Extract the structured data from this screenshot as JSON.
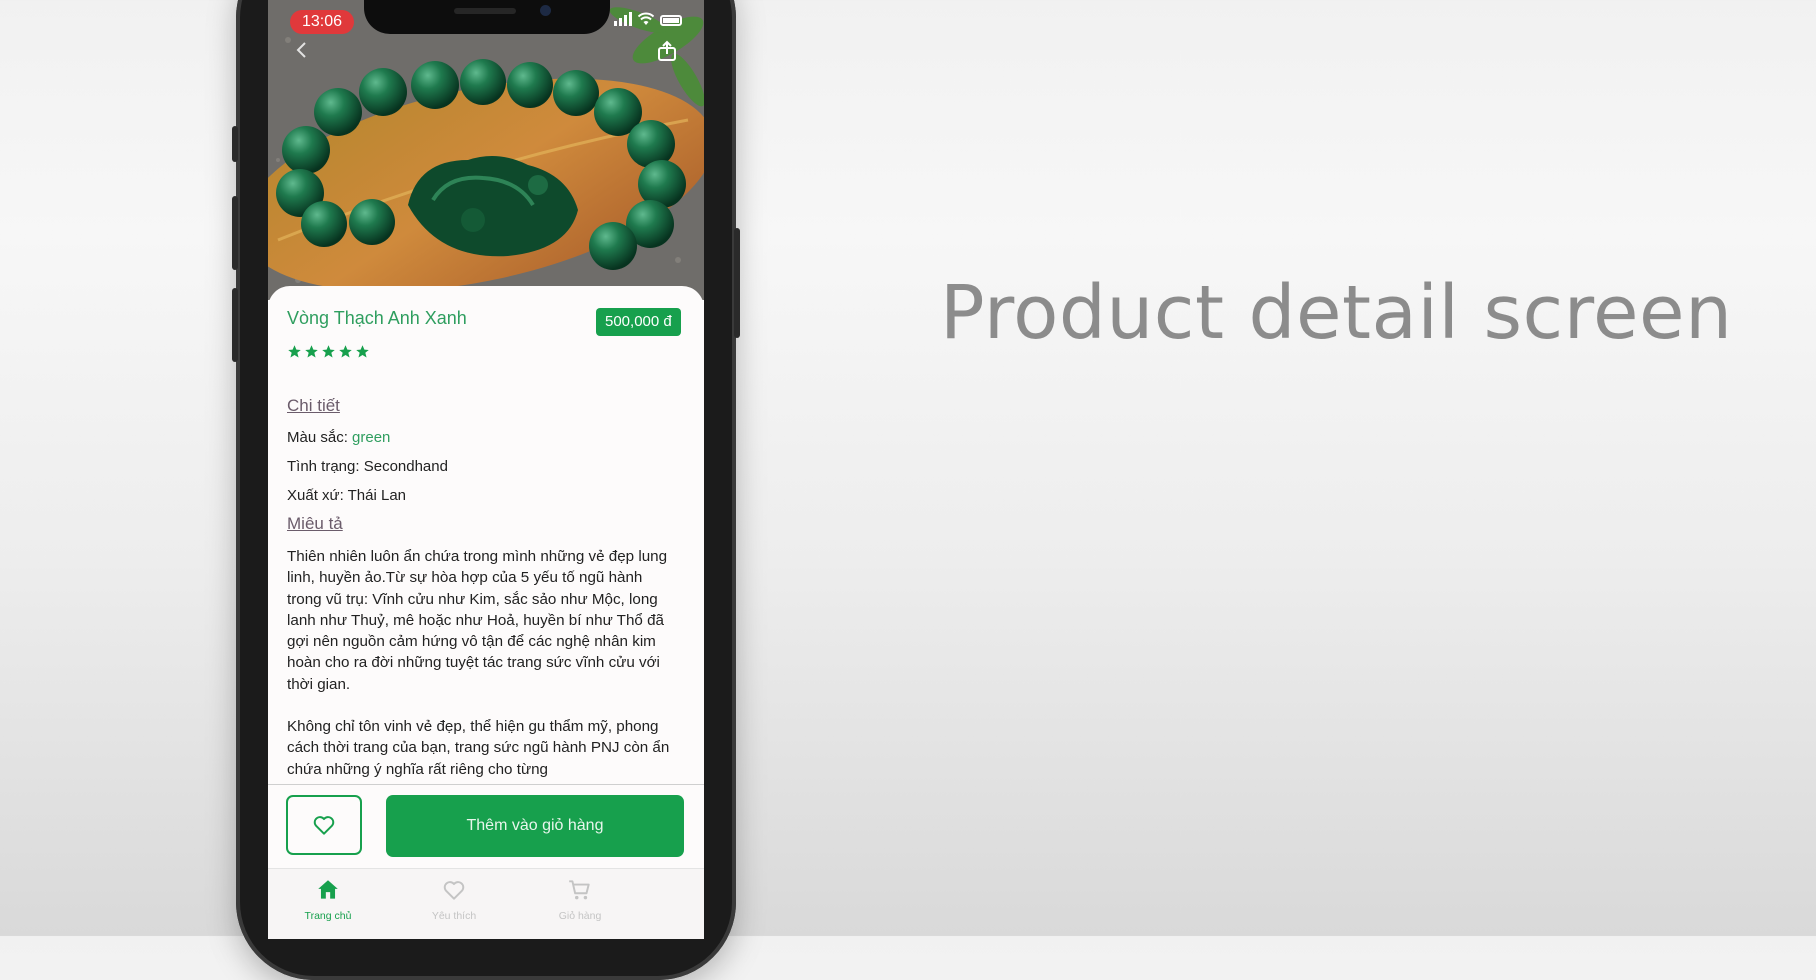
{
  "slide": {
    "title": "Product detail screen"
  },
  "status_bar": {
    "time": "13:06"
  },
  "product": {
    "name": "Vòng Thạch Anh Xanh",
    "price": "500,000 đ",
    "rating_stars": 5
  },
  "details": {
    "section_title": "Chi tiết",
    "color_label": "Màu sắc:",
    "color_value": "green",
    "condition_label": "Tình trạng:",
    "condition_value": "Secondhand",
    "origin_label": "Xuất xứ:",
    "origin_value": "Thái Lan"
  },
  "description": {
    "section_title": "Miêu tả",
    "paragraph_1": "Thiên nhiên luôn ẩn chứa trong mình những vẻ đẹp lung linh, huyền ảo.Từ sự hòa hợp của 5 yếu tố ngũ hành trong vũ trụ: Vĩnh cửu như Kim, sắc sảo như Mộc, long lanh như Thuỷ, mê hoặc như Hoả, huyền bí như Thổ đã gợi nên nguồn cảm hứng vô tận để các nghệ nhân kim hoàn cho ra đời những tuyệt tác trang sức vĩnh cửu với thời gian.",
    "paragraph_2": "Không chỉ tôn vinh vẻ đẹp, thể hiện gu thẩm mỹ, phong cách thời trang của bạn, trang sức ngũ hành PNJ còn ẩn chứa những ý nghĩa rất riêng cho từng"
  },
  "actions": {
    "add_to_cart": "Thêm vào giỏ hàng"
  },
  "tabs": [
    {
      "label": "Trang chủ",
      "icon": "home-icon",
      "active": true
    },
    {
      "label": "Yêu thích",
      "icon": "heart-icon",
      "active": false
    },
    {
      "label": "Giỏ hàng",
      "icon": "cart-icon",
      "active": false
    }
  ],
  "colors": {
    "accent": "#17a04d",
    "accent_text": "#2f9e5f",
    "inactive_tab": "#c4c4c4"
  }
}
